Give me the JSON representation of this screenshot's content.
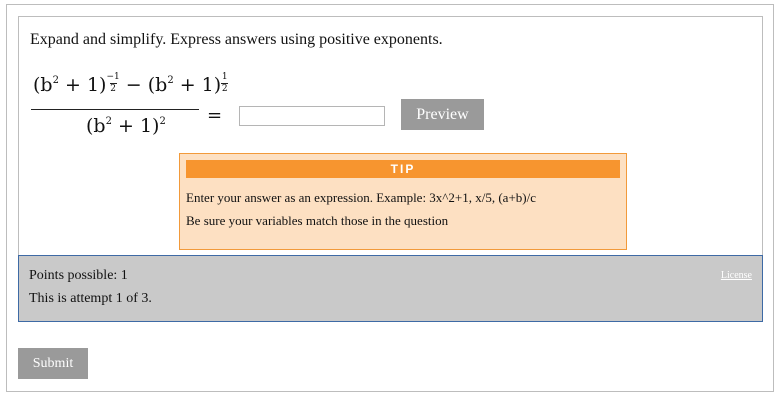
{
  "question": {
    "prompt": "Expand and simplify. Express answers using positive exponents.",
    "expression": {
      "numerator_left_base": "(b",
      "numerator_left_inner_exp": "2",
      "numerator_left_rest": " + 1)",
      "numerator_left_sign": "−",
      "numerator_left_exp_num": "1",
      "numerator_left_exp_den": "2",
      "operator": " − ",
      "numerator_right_base": "(b",
      "numerator_right_inner_exp": "2",
      "numerator_right_rest": " + 1)",
      "numerator_right_exp_num": "1",
      "numerator_right_exp_den": "2",
      "denominator_base": "(b",
      "denominator_inner_exp": "2",
      "denominator_rest": " + 1)",
      "denominator_exp": "2"
    },
    "equals": "=",
    "answer_value": "",
    "preview_label": "Preview"
  },
  "tip": {
    "heading": "TIP",
    "line1": "Enter your answer as an expression. Example: 3x^2+1, x/5, (a+b)/c",
    "line2": "Be sure your variables match those in the question"
  },
  "info": {
    "points": "Points possible: 1",
    "attempt": "This is attempt 1 of 3.",
    "license_label": "License"
  },
  "actions": {
    "submit_label": "Submit"
  },
  "colors": {
    "button_gray": "#9a9a9a",
    "tip_orange": "#f7952f",
    "tip_background": "#fde0c2",
    "info_background": "#c9c9c9",
    "info_border": "#3e6aa5"
  }
}
